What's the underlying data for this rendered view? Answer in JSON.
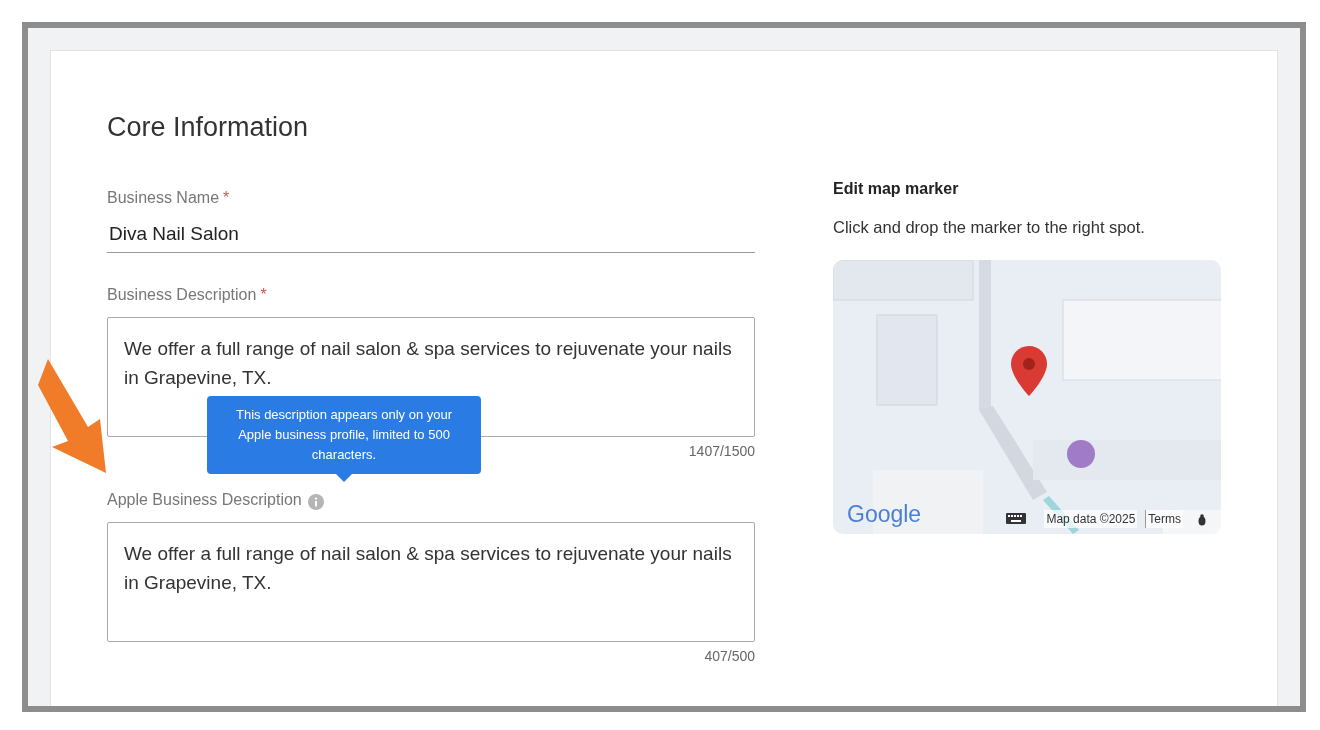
{
  "section": {
    "title": "Core Information"
  },
  "fields": [
    {
      "kind": "text",
      "label": "Business Name",
      "required_mark": "*",
      "value": "Diva Nail Salon"
    },
    {
      "kind": "textarea",
      "label": "Business Description",
      "required_mark": "*",
      "value": "We offer a full range of nail salon & spa services to rejuvenate your nails in Grapevine, TX.",
      "counter": "1407/1500"
    },
    {
      "kind": "textarea",
      "label": "Apple Business Description",
      "tooltip": "This description appears only on your Apple business profile, limited to 500 characters.",
      "value": "We offer a full range of nail salon & spa services to rejuvenate your nails in Grapevine, TX.",
      "counter": "407/500"
    }
  ],
  "map": {
    "title": "Edit map marker",
    "hint": "Click and drop the marker to the right spot.",
    "logo": "Google",
    "attribution": "Map data ©2025",
    "terms": "Terms"
  }
}
